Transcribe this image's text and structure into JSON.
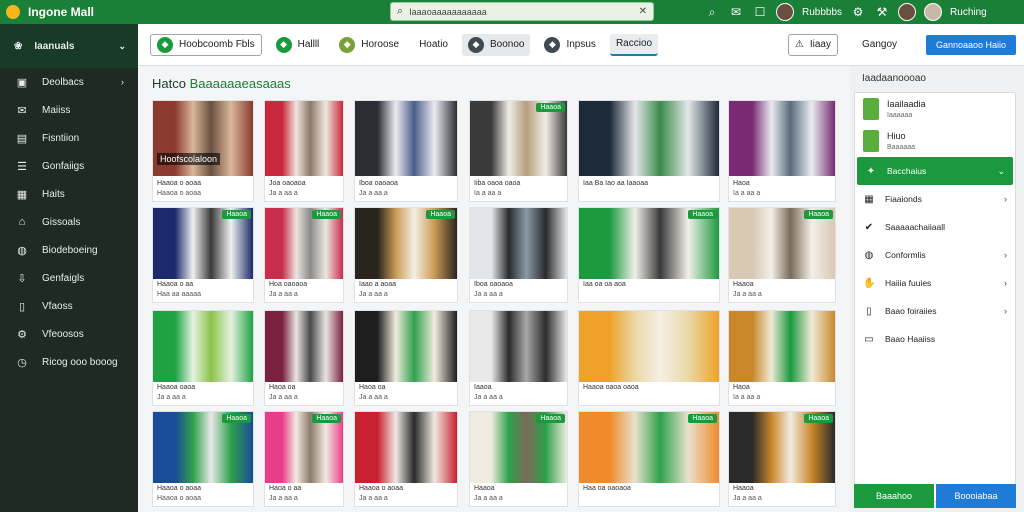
{
  "app": {
    "brand": "Ingone Mall"
  },
  "search": {
    "placeholder": "Iaaaoaaaaaaaaaaa"
  },
  "topbar": {
    "user1": "Rubbbbs",
    "user2": "Ruching"
  },
  "sidebar": {
    "header": "Iaanuals",
    "items": [
      {
        "icon": "image-icon",
        "label": "Deolbacs",
        "has_chevron": true
      },
      {
        "icon": "inbox-icon",
        "label": "Maiiss",
        "has_chevron": false
      },
      {
        "icon": "archive-icon",
        "label": "Fisntiion",
        "has_chevron": false
      },
      {
        "icon": "mail-icon",
        "label": "Gonfaiigs",
        "has_chevron": false
      },
      {
        "icon": "grid-icon",
        "label": "Haits",
        "has_chevron": false
      },
      {
        "icon": "home-icon",
        "label": "Gissoals",
        "has_chevron": false
      },
      {
        "icon": "globe-icon",
        "label": "Biodeboeing",
        "has_chevron": false
      },
      {
        "icon": "download-icon",
        "label": "Genfaigls",
        "has_chevron": false
      },
      {
        "icon": "document-icon",
        "label": "Vfaoss",
        "has_chevron": false
      },
      {
        "icon": "gear-icon",
        "label": "Vfeoosos",
        "has_chevron": false
      },
      {
        "icon": "clock-icon",
        "label": "Ricog ooo booog",
        "has_chevron": false
      }
    ]
  },
  "toolbar": {
    "items": [
      {
        "icon": "a",
        "label": "Hoobcoomb Fbls",
        "style": "box"
      },
      {
        "icon": "a",
        "label": "Hallll",
        "style": "plain"
      },
      {
        "icon": "b",
        "label": "Horoose",
        "style": "plain"
      },
      {
        "icon": "",
        "label": "Hoatio",
        "style": "plain"
      },
      {
        "icon": "c",
        "label": "Boonoo",
        "style": "grey"
      },
      {
        "icon": "c",
        "label": "Inpsus",
        "style": "plain"
      },
      {
        "icon": "",
        "label": "Raccioo",
        "style": "tab"
      }
    ],
    "right_label": "Iiaay"
  },
  "main": {
    "title_plain": "Hatco ",
    "title_highlight": "Baaaaaaeasaaas"
  },
  "grid": {
    "cards": [
      {
        "cap": "Haaoa o aoaa",
        "sub": "Haaoa o aoaa",
        "badge": "",
        "overlay": "Hoofscolaloon",
        "colors": [
          "#8b3a2f",
          "#d9b89a",
          "#6a5040"
        ]
      },
      {
        "cap": "Joa oaoaoa",
        "sub": "Ja a aa a",
        "badge": "",
        "overlay": "",
        "colors": [
          "#c8283d",
          "#f1e6dd",
          "#8c7a6a"
        ]
      },
      {
        "cap": "Iboa oaoaoa",
        "sub": "Ja a aa a",
        "badge": "",
        "overlay": "",
        "colors": [
          "#2a2d33",
          "#e9ecef",
          "#4b5c8a"
        ]
      },
      {
        "cap": "Iiba oaoa oaoa",
        "sub": "Ia a aa a",
        "badge": "Haaoa",
        "overlay": "",
        "colors": [
          "#3a3a3a",
          "#f0ede7",
          "#b59f7a"
        ]
      },
      {
        "cap": "Iaa Ba Iao aa Iaaoaa",
        "sub": "",
        "badge": "",
        "overlay": "",
        "colors": [
          "#1c2a38",
          "#e4e7ea",
          "#3b8a4a"
        ]
      },
      {
        "cap": "Haoa",
        "sub": "Ia a aa a",
        "badge": "",
        "overlay": "",
        "colors": [
          "#7a2a72",
          "#e8ecf0",
          "#5a6b7c"
        ]
      },
      {
        "cap": "Haaoa o aa",
        "sub": "Haa aa aaaaa",
        "badge": "Haaoa",
        "overlay": "",
        "colors": [
          "#1a2a6a",
          "#f0f0f0",
          "#3a3a3a"
        ]
      },
      {
        "cap": "Hoa oaoaoa",
        "sub": "Ja a aa a",
        "badge": "Haaoa",
        "overlay": "",
        "colors": [
          "#c92d4b",
          "#ebe5df",
          "#8b8b8b"
        ]
      },
      {
        "cap": "Iaao a aoaa",
        "sub": "Ja a aa a",
        "badge": "Haaoa",
        "overlay": "",
        "colors": [
          "#2a241e",
          "#c99a55",
          "#f5efe5"
        ]
      },
      {
        "cap": "Iboa oaoaoa",
        "sub": "Ja a aa a",
        "badge": "",
        "overlay": "",
        "colors": [
          "#e2e6ea",
          "#2a2a2a",
          "#8a9aa8"
        ]
      },
      {
        "cap": "Iaa oa oa aoa",
        "sub": "",
        "badge": "Haaoa",
        "overlay": "",
        "colors": [
          "#1b9a3e",
          "#f1efe9",
          "#3a3a3a"
        ]
      },
      {
        "cap": "Haaoa",
        "sub": "Ja a aa a",
        "badge": "Haaoa",
        "overlay": "",
        "colors": [
          "#d8c8b4",
          "#f3efe8",
          "#7a6a5a"
        ]
      },
      {
        "cap": "Haaoa oaoa",
        "sub": "Ja a aa a",
        "badge": "",
        "overlay": "",
        "colors": [
          "#1ea242",
          "#e5f2e0",
          "#8bc34a"
        ]
      },
      {
        "cap": "Haoa oa",
        "sub": "Ja a aa a",
        "badge": "",
        "overlay": "",
        "colors": [
          "#7a2040",
          "#e9e4e0",
          "#4a4a4a"
        ]
      },
      {
        "cap": "Haoa oa",
        "sub": "Ja a aa a",
        "badge": "",
        "overlay": "",
        "colors": [
          "#1e1e1e",
          "#f2ebdf",
          "#2ea14a"
        ]
      },
      {
        "cap": "Iaaoa",
        "sub": "Ja a aa a",
        "badge": "",
        "overlay": "",
        "colors": [
          "#e9e9e9",
          "#2c2c2c",
          "#a8a8a8"
        ]
      },
      {
        "cap": "Haaoa oaoa oaoa",
        "sub": "",
        "badge": "",
        "overlay": "",
        "colors": [
          "#f0a12a",
          "#e9d9a8",
          "#f6efe5"
        ]
      },
      {
        "cap": "Haoa",
        "sub": "Ia a aa a",
        "badge": "",
        "overlay": "",
        "colors": [
          "#c9872a",
          "#f0ead8",
          "#1b9a3e"
        ]
      },
      {
        "cap": "Haaoa o aoaa",
        "sub": "Haaoa o aoaa",
        "badge": "Haaoa",
        "overlay": "",
        "colors": [
          "#1a4a9a",
          "#2ea14a",
          "#e8e8e8"
        ]
      },
      {
        "cap": "Haoa o aa",
        "sub": "Ja a aa a",
        "badge": "Haaoa",
        "overlay": "",
        "colors": [
          "#e83d8a",
          "#f2ebe0",
          "#8a7a6a"
        ]
      },
      {
        "cap": "Haaoa o aoaa",
        "sub": "Ja a aa a",
        "badge": "",
        "overlay": "",
        "colors": [
          "#c82030",
          "#efe9e0",
          "#2a2a2a"
        ]
      },
      {
        "cap": "Haaoa",
        "sub": "Ja a aa a",
        "badge": "Haaoa",
        "overlay": "",
        "colors": [
          "#f0ebe0",
          "#2ea14a",
          "#7a6a5a"
        ]
      },
      {
        "cap": "Haa oa oaoaoa",
        "sub": "",
        "badge": "Haaoa",
        "overlay": "",
        "colors": [
          "#f08a2a",
          "#e9e1cf",
          "#2ea14a"
        ]
      },
      {
        "cap": "Haaoa",
        "sub": "Ja a aa a",
        "badge": "Haaoa",
        "overlay": "",
        "colors": [
          "#2a2a2a",
          "#c9872a",
          "#f1ebe2"
        ]
      }
    ]
  },
  "rpanel": {
    "head_label": "Gangoy",
    "head_button": "Gannoaaoo Haiio",
    "sub_title": "Iaadaanoooao",
    "cards": [
      {
        "title": "Iaailaadia",
        "sub": "Iaaaaaa"
      },
      {
        "title": "Hiuo",
        "sub": "Baaaaaa"
      }
    ],
    "items": [
      {
        "icon": "star-icon",
        "label": "Bacchaius",
        "active": true,
        "chevron": "⌄"
      },
      {
        "icon": "grid-icon",
        "label": "Fiaaionds",
        "active": false,
        "chevron": "›"
      },
      {
        "icon": "check-icon",
        "label": "Saaaaachaiiaall",
        "active": false,
        "chevron": ""
      },
      {
        "icon": "globe-icon",
        "label": "Conformlis",
        "active": false,
        "chevron": "›"
      },
      {
        "icon": "hand-icon",
        "label": "Haiiia fuuies",
        "active": false,
        "chevron": "›"
      },
      {
        "icon": "document-icon",
        "label": "Baao foiraiies",
        "active": false,
        "chevron": "›"
      },
      {
        "icon": "layout-icon",
        "label": "Baao Haaiiss",
        "active": false,
        "chevron": ""
      }
    ],
    "foot_left": "Baaahoo",
    "foot_right": "Boooiabaa"
  }
}
